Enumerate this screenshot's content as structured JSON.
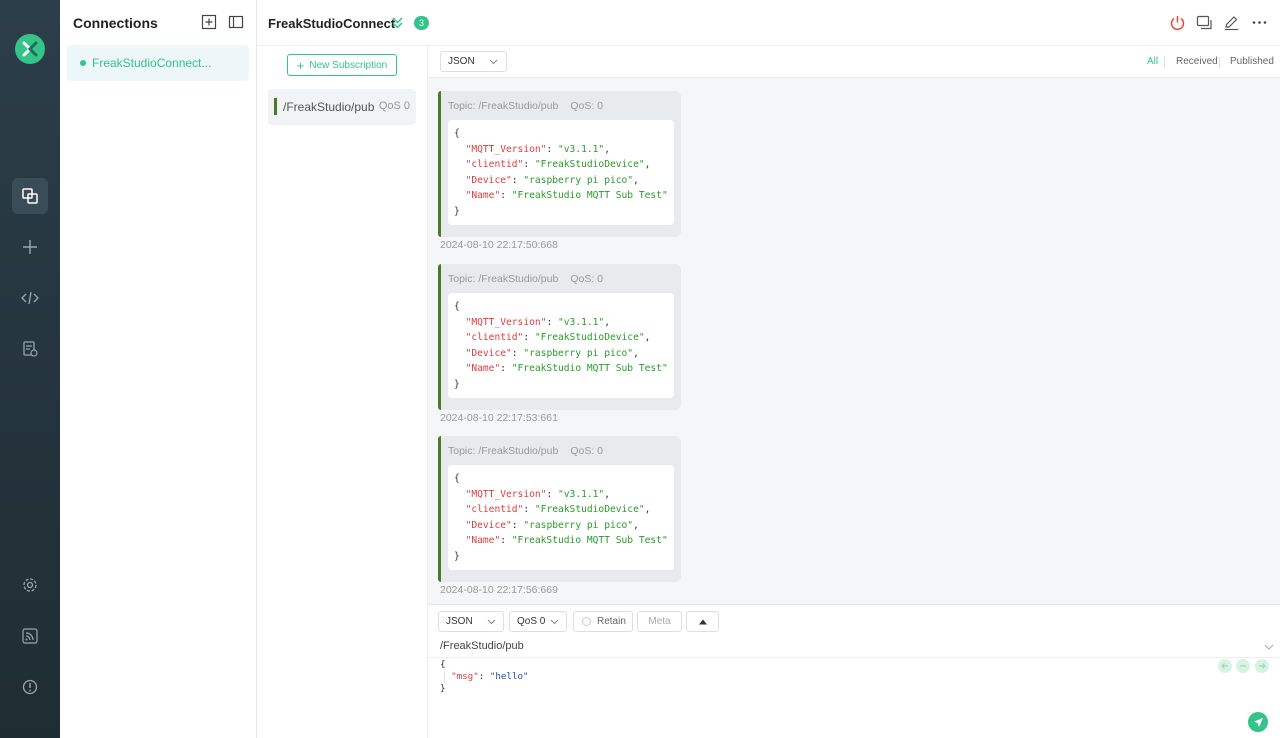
{
  "sidebar_nav": {
    "items": [
      {
        "icon": "connections-icon",
        "active": true
      },
      {
        "icon": "plus-icon",
        "active": false
      },
      {
        "icon": "code-icon",
        "active": false
      },
      {
        "icon": "log-icon",
        "active": false
      },
      {
        "icon": "settings-icon",
        "active": false
      },
      {
        "icon": "feed-icon",
        "active": false
      },
      {
        "icon": "info-icon",
        "active": false
      }
    ]
  },
  "connections": {
    "title": "Connections",
    "items": [
      {
        "name": "FreakStudioConnect...",
        "status_color": "#34c388"
      }
    ]
  },
  "header": {
    "title": "FreakStudioConnect",
    "badge": "3"
  },
  "subscriptions": {
    "new_button": "New Subscription",
    "items": [
      {
        "topic": "/FreakStudio/pub",
        "qos": "QoS 0",
        "color": "#4a7a2a"
      }
    ]
  },
  "message_toolbar": {
    "format": "JSON",
    "filters": [
      "All",
      "Received",
      "Published"
    ],
    "active_filter": "All"
  },
  "messages": [
    {
      "topic_label": "Topic: /FreakStudio/pub",
      "qos_label": "QoS: 0",
      "time": "2024-08-10 22:17:50:668",
      "payload": [
        {
          "key": "\"MQTT_Version\"",
          "value": "\"v3.1.1\"",
          "comma": ","
        },
        {
          "key": "\"clientid\"",
          "value": "\"FreakStudioDevice\"",
          "comma": ","
        },
        {
          "key": "\"Device\"",
          "value": "\"raspberry pi pico\"",
          "comma": ","
        },
        {
          "key": "\"Name\"",
          "value": "\"FreakStudio MQTT Sub Test\"",
          "comma": ""
        }
      ]
    },
    {
      "topic_label": "Topic: /FreakStudio/pub",
      "qos_label": "QoS: 0",
      "time": "2024-08-10 22:17:53:661",
      "payload": [
        {
          "key": "\"MQTT_Version\"",
          "value": "\"v3.1.1\"",
          "comma": ","
        },
        {
          "key": "\"clientid\"",
          "value": "\"FreakStudioDevice\"",
          "comma": ","
        },
        {
          "key": "\"Device\"",
          "value": "\"raspberry pi pico\"",
          "comma": ","
        },
        {
          "key": "\"Name\"",
          "value": "\"FreakStudio MQTT Sub Test\"",
          "comma": ""
        }
      ]
    },
    {
      "topic_label": "Topic: /FreakStudio/pub",
      "qos_label": "QoS: 0",
      "time": "2024-08-10 22:17:56:669",
      "payload": [
        {
          "key": "\"MQTT_Version\"",
          "value": "\"v3.1.1\"",
          "comma": ","
        },
        {
          "key": "\"clientid\"",
          "value": "\"FreakStudioDevice\"",
          "comma": ","
        },
        {
          "key": "\"Device\"",
          "value": "\"raspberry pi pico\"",
          "comma": ","
        },
        {
          "key": "\"Name\"",
          "value": "\"FreakStudio MQTT Sub Test\"",
          "comma": ""
        }
      ]
    }
  ],
  "compose": {
    "format": "JSON",
    "qos": "QoS 0",
    "retain_label": "Retain",
    "meta_label": "Meta",
    "topic": "/FreakStudio/pub",
    "payload_key": "\"msg\"",
    "payload_value": "\"hello\""
  },
  "colors": {
    "accent": "#34c388",
    "nav_bg": "#2c3e4a",
    "json_key": "#e23b3b",
    "json_string": "#2a9a2a"
  }
}
